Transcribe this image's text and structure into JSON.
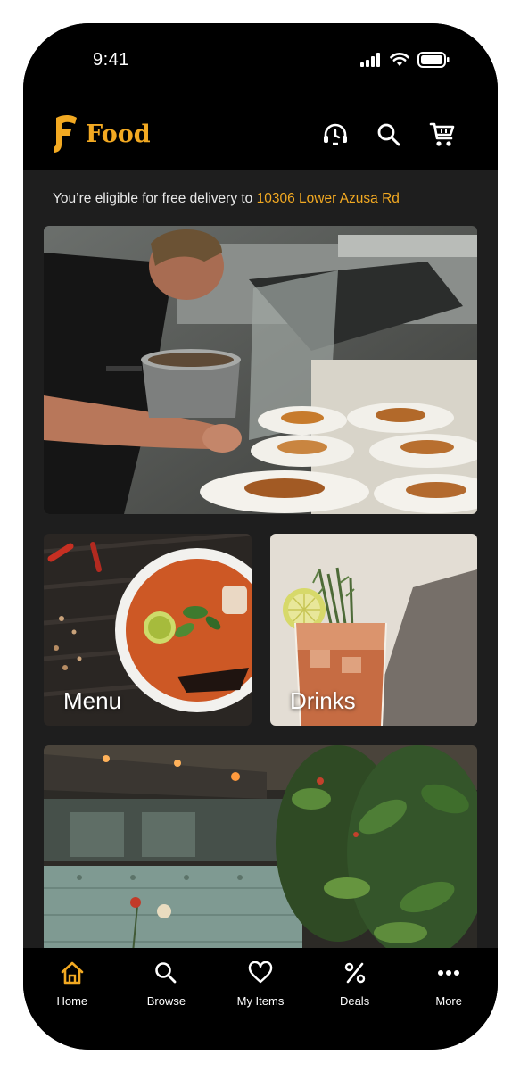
{
  "status_bar": {
    "time": "9:41"
  },
  "header": {
    "brand_name": "Food",
    "actions": [
      {
        "name": "support-icon"
      },
      {
        "name": "search-icon"
      },
      {
        "name": "cart-icon"
      }
    ]
  },
  "delivery": {
    "prefix": "You’re eligible for free delivery to ",
    "address": "10306 Lower Azusa Rd"
  },
  "cards": {
    "menu_label": "Menu",
    "drinks_label": "Drinks"
  },
  "nav": {
    "items": [
      {
        "label": "Home",
        "icon": "home-icon",
        "active": true
      },
      {
        "label": "Browse",
        "icon": "search-icon",
        "active": false
      },
      {
        "label": "My Items",
        "icon": "heart-icon",
        "active": false
      },
      {
        "label": "Deals",
        "icon": "percent-icon",
        "active": false
      },
      {
        "label": "More",
        "icon": "more-icon",
        "active": false
      }
    ]
  },
  "colors": {
    "accent": "#f2a922",
    "background": "#1e1e1e",
    "bar": "#000000"
  }
}
